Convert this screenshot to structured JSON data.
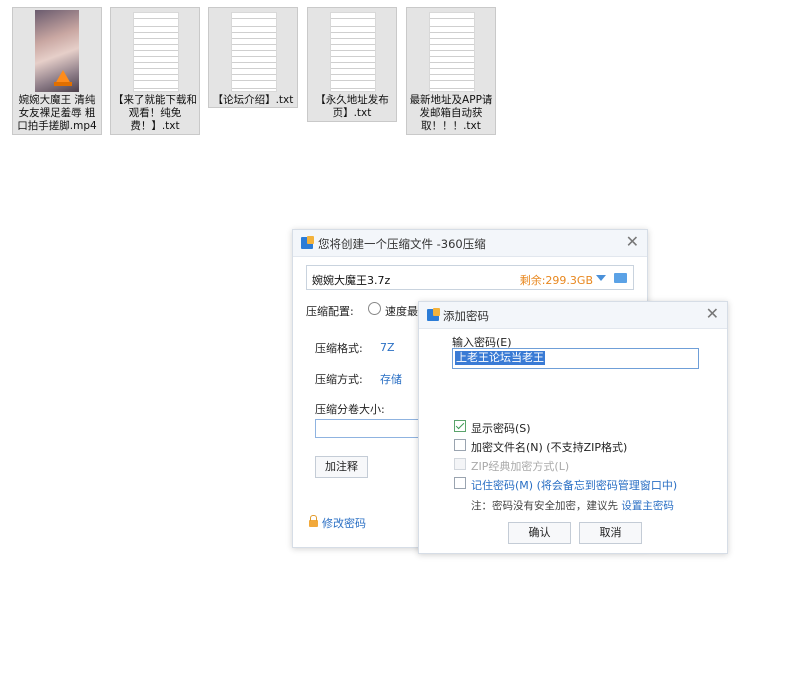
{
  "desktop": {
    "files": [
      {
        "name": "婉婉大魔王 清纯女友裸足羞辱 粗口拍手搓脚.mp4",
        "kind": "video"
      },
      {
        "name": "【来了就能下载和观看！纯免费！】.txt",
        "kind": "text"
      },
      {
        "name": "【论坛介绍】.txt",
        "kind": "text"
      },
      {
        "name": "【永久地址发布页】.txt",
        "kind": "text"
      },
      {
        "name": "最新地址及APP请发邮箱自动获取！！！.txt",
        "kind": "text"
      }
    ]
  },
  "compress_dialog": {
    "title": "您将创建一个压缩文件 -360压缩",
    "close": "✕",
    "filename": "婉婉大魔王3.7z",
    "free_space": "剩余:299.3GB",
    "config_label": "压缩配置:",
    "config_option": "速度最",
    "format_label": "压缩格式:",
    "format_value": "7Z",
    "method_label": "压缩方式:",
    "method_value": "存储",
    "split_label": "压缩分卷大小:",
    "comment_button": "加注释",
    "change_password_link": "修改密码"
  },
  "password_dialog": {
    "title": "添加密码",
    "close": "✕",
    "input_label": "输入密码(E)",
    "password_value": "上老王论坛当老王",
    "show_password": {
      "label": "显示密码(S)",
      "checked": true
    },
    "encrypt_names": {
      "label": "加密文件名(N) (不支持ZIP格式)",
      "checked": false
    },
    "zip_classic": {
      "label": "ZIP经典加密方式(L)",
      "checked": false,
      "disabled": true
    },
    "remember": {
      "label": "记住密码(M) (将会备忘到密码管理窗口中)",
      "checked": false
    },
    "note_prefix": "注：密码没有安全加密，建议先",
    "note_link": "设置主密码",
    "ok_button": "确认",
    "cancel_button": "取消"
  },
  "colors": {
    "accent": "#2a6fc4",
    "free_space": "#e8871e",
    "selection": "#3a7bd5"
  }
}
